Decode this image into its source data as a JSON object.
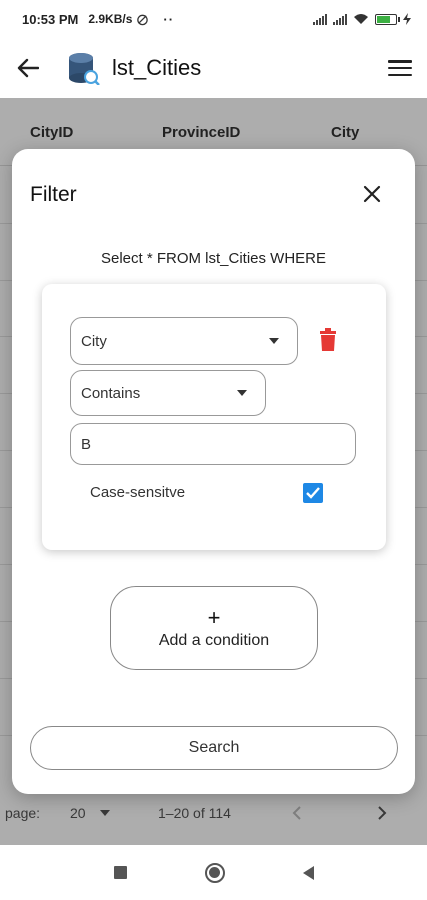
{
  "status_bar": {
    "time": "10:53 PM",
    "speed": "2.9KB/s",
    "dots": "··"
  },
  "app_bar": {
    "title": "lst_Cities",
    "icons": [
      "back-arrow-icon",
      "database-icon",
      "menu-icon"
    ]
  },
  "table": {
    "columns": [
      "CityID",
      "ProvinceID",
      "City"
    ]
  },
  "pager": {
    "rows_label": "page:",
    "rows_per_page": "20",
    "range": "1–20 of 114"
  },
  "dialog": {
    "title": "Filter",
    "query": "Select * FROM lst_Cities WHERE",
    "condition": {
      "column": "City",
      "operator": "Contains",
      "value": "B",
      "case_sensitive_label": "Case-sensitve",
      "case_sensitive": true
    },
    "add_condition_plus": "+",
    "add_condition_label": "Add a condition",
    "search_label": "Search"
  },
  "colors": {
    "accent": "#1e88e5",
    "delete": "#e53935",
    "battery": "#3cb043"
  }
}
